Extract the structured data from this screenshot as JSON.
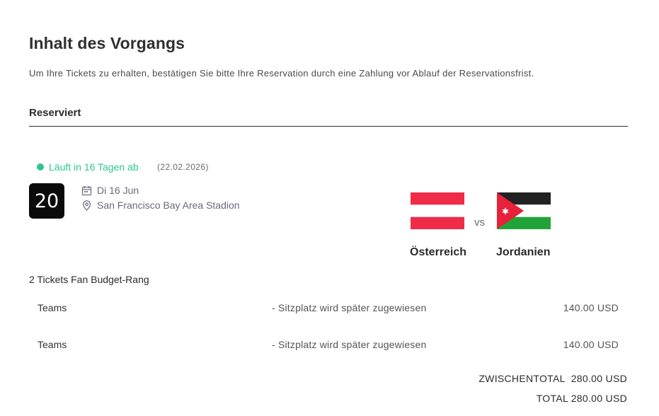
{
  "header": {
    "title": "Inhalt des Vorgangs",
    "description": "Um Ihre Tickets zu erhalten, bestätigen Sie bitte Ihre Reservation durch eine Zahlung vor Ablauf der Reservationsfrist."
  },
  "section": {
    "title": "Reserviert"
  },
  "reservation": {
    "status_text": "Läuft in 16 Tagen ab",
    "status_date": "(22.02.2026)",
    "status_color": "#2fc493"
  },
  "match": {
    "number": "20",
    "date": "Di 16 Jun",
    "venue": "San Francisco Bay Area Stadion",
    "date_icon": "calendar-icon",
    "venue_icon": "location-pin-icon",
    "home_team": "Österreich",
    "away_team": "Jordanien",
    "vs_label": "vs",
    "home_flag_icon": "austria-flag-icon",
    "away_flag_icon": "jordan-flag-icon"
  },
  "tickets": {
    "type_label": "2 Tickets Fan Budget-Rang",
    "rows": [
      {
        "label": "Teams",
        "seat": "- Sitzplatz wird später zugewiesen",
        "price": "140.00 USD"
      },
      {
        "label": "Teams",
        "seat": "- Sitzplatz wird später zugewiesen",
        "price": "140.00 USD"
      }
    ]
  },
  "totals": {
    "subtotal_label": "ZWISCHENTOTAL",
    "subtotal_value": "280.00 USD",
    "total_label": "TOTAL",
    "total_value": "280.00 USD"
  }
}
